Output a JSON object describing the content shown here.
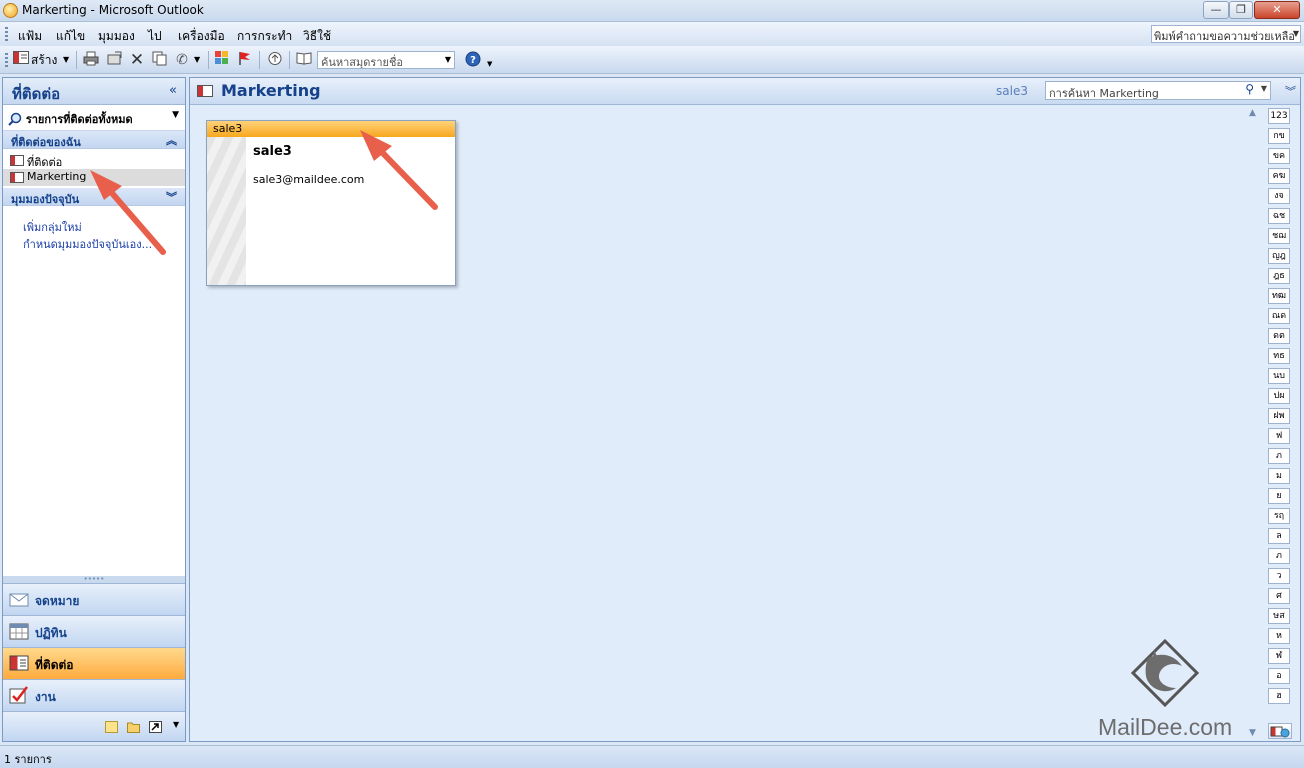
{
  "window": {
    "title": "Markerting - Microsoft Outlook",
    "minimize": "—",
    "restore": "❐",
    "close": "✕"
  },
  "menu": {
    "items": [
      "แฟ้ม",
      "แก้ไข",
      "มุมมอง",
      "ไป",
      "เครื่องมือ",
      "การกระทำ",
      "วิธีใช้"
    ],
    "help_placeholder": "พิมพ์คำถามขอความช่วยเหลือ"
  },
  "toolbar": {
    "new_label": "สร้าง",
    "address_search_placeholder": "ค้นหาสมุดรายชื่อ"
  },
  "nav": {
    "header": "ที่ติดต่อ",
    "collapse": "«",
    "all_contacts": "รายการที่ติดต่อทั้งหมด",
    "my_contacts_header": "ที่ติดต่อของฉัน",
    "folders": [
      {
        "label": "ที่ติดต่อ"
      },
      {
        "label": "Markerting"
      }
    ],
    "current_view_header": "มุมมองปัจจุบัน",
    "links": [
      "เพิ่มกลุ่มใหม่",
      "กำหนดมุมมองปัจจุบันเอง..."
    ],
    "buttons": [
      {
        "label": "จดหมาย"
      },
      {
        "label": "ปฏิทิน"
      },
      {
        "label": "ที่ติดต่อ"
      },
      {
        "label": "งาน"
      }
    ]
  },
  "content": {
    "title": "Markerting",
    "current_user": "sale3",
    "search_placeholder": "การค้นหา Markerting"
  },
  "card": {
    "header": "sale3",
    "name": "sale3",
    "email": "sale3@maildee.com"
  },
  "index": [
    "123",
    "กข",
    "ขค",
    "คฆ",
    "งจ",
    "ฉช",
    "ชฌ",
    "ญฎ",
    "ฎธ",
    "ทฒ",
    "ณด",
    "ดต",
    "ทธ",
    "นบ",
    "ปผ",
    "ฝพ",
    "ฟ",
    "ภ",
    "ม",
    "ย",
    "รฤ",
    "ล",
    "ภ",
    "ว",
    "ศ",
    "ษส",
    "ห",
    "ฬ",
    "อ",
    "ฮ"
  ],
  "watermark": "MailDee.com",
  "status": {
    "text": "1 รายการ"
  },
  "colors": {
    "accent": "#15428b",
    "card_header": "#f7a71e",
    "active_nav": "#ffab3f",
    "arrow": "#e8604c"
  }
}
